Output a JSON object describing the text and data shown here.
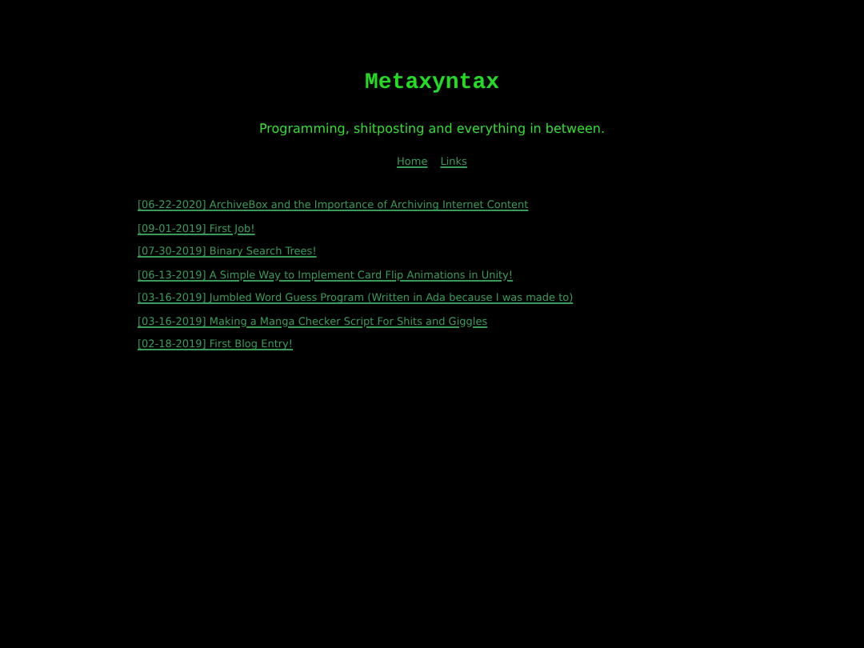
{
  "site_title": "Metaxyntax",
  "tagline": "Programming, shitposting and everything in between.",
  "nav": [
    "Home",
    "Links"
  ],
  "posts": [
    "[06-22-2020] ArchiveBox and the Importance of Archiving Internet Content",
    "[09-01-2019] First Job!",
    "[07-30-2019] Binary Search Trees!",
    "[06-13-2019] A Simple Way to Implement Card Flip Animations in Unity!",
    "[03-16-2019] Jumbled Word Guess Program (Written in Ada because I was made to)",
    "[03-16-2019] Making a Manga Checker Script For Shits and Giggles",
    "[02-18-2019] First Blog Entry!"
  ]
}
